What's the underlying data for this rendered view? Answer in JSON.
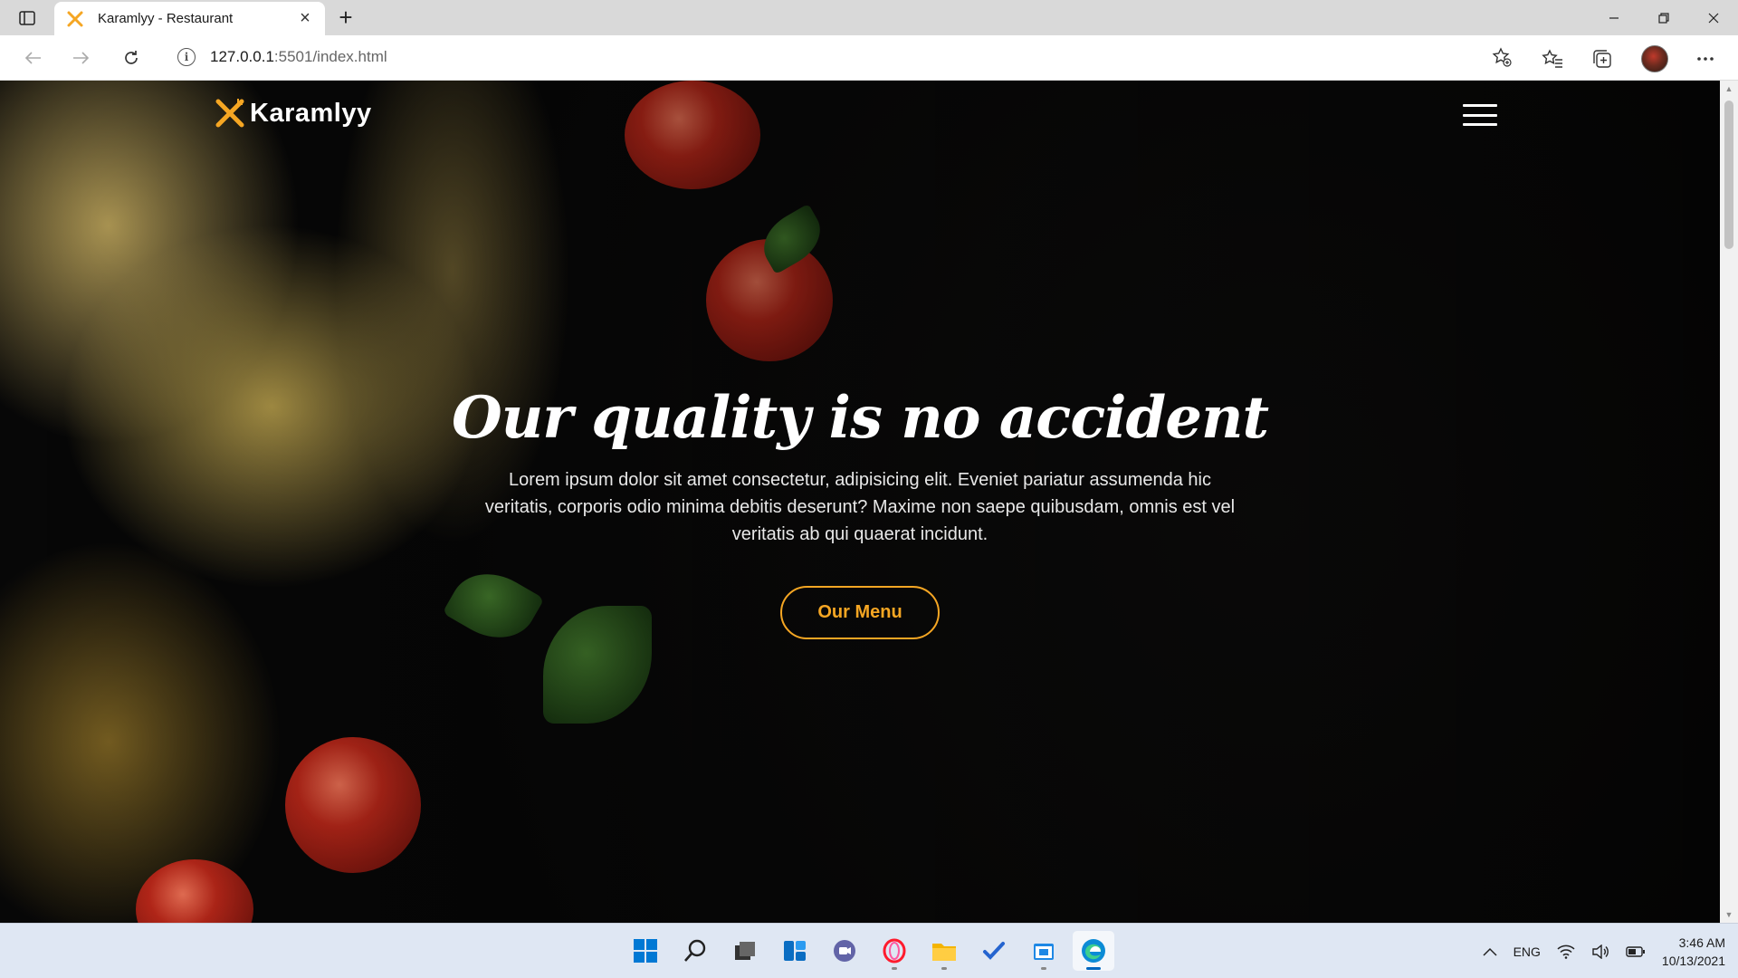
{
  "browser": {
    "tab_title": "Karamlyy - Restaurant",
    "tab_close": "×",
    "new_tab": "+",
    "url_host": "127.0.0.1",
    "url_rest": ":5501/index.html"
  },
  "site": {
    "logo_text": "Karamlyy",
    "hero_title": "Our quality is no accident",
    "hero_text": "Lorem ipsum dolor sit amet consectetur, adipisicing elit. Eveniet pariatur assumenda hic veritatis, corporis odio minima debitis deserunt? Maxime non saepe quibusdam, omnis est vel veritatis ab qui quaerat incidunt.",
    "menu_button": "Our Menu",
    "accent_color": "#f5a623"
  },
  "taskbar": {
    "language": "ENG",
    "time": "3:46 AM",
    "date": "10/13/2021",
    "apps": [
      "start-icon",
      "search-icon",
      "task-view-icon",
      "widgets-icon",
      "teams-chat-icon",
      "opera-icon",
      "file-explorer-icon",
      "todo-icon",
      "store-icon",
      "edge-icon"
    ]
  }
}
